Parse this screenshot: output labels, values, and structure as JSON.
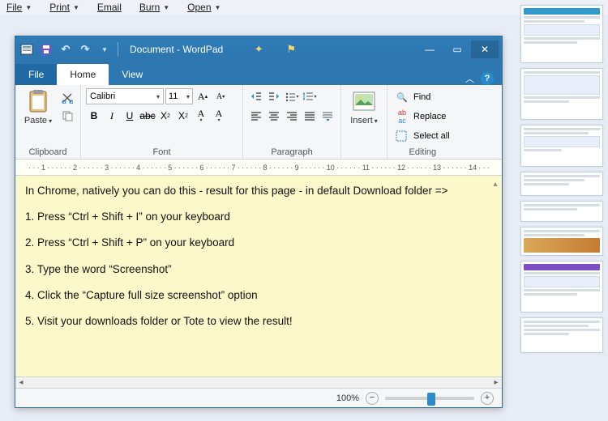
{
  "outer_menu": {
    "file": "File",
    "print": "Print",
    "email": "Email",
    "burn": "Burn",
    "open": "Open"
  },
  "window": {
    "title": "Document - WordPad"
  },
  "tabs": {
    "file": "File",
    "home": "Home",
    "view": "View"
  },
  "ribbon": {
    "clipboard": {
      "label": "Clipboard",
      "paste": "Paste"
    },
    "font": {
      "label": "Font",
      "family": "Calibri",
      "size": "11"
    },
    "paragraph": {
      "label": "Paragraph"
    },
    "insert": {
      "label": "Insert"
    },
    "editing": {
      "label": "Editing",
      "find": "Find",
      "replace": "Replace",
      "select_all": "Select all"
    }
  },
  "document": {
    "p1": "In Chrome, natively you can do this - result for this page  - in default Download folder =>",
    "p2": "1. Press “Ctrl + Shift + I” on your keyboard",
    "p3": "2. Press “Ctrl + Shift + P” on your keyboard",
    "p4": "3. Type the word “Screenshot”",
    "p5": "4. Click the “Capture full size screenshot” option",
    "p6": "5. Visit your downloads folder or Tote to view the result!"
  },
  "status": {
    "zoom": "100%"
  },
  "ruler": {
    "marks": [
      "1",
      "2",
      "3",
      "4",
      "5",
      "6",
      "7",
      "8",
      "9",
      "10",
      "11",
      "12",
      "13",
      "14"
    ]
  }
}
